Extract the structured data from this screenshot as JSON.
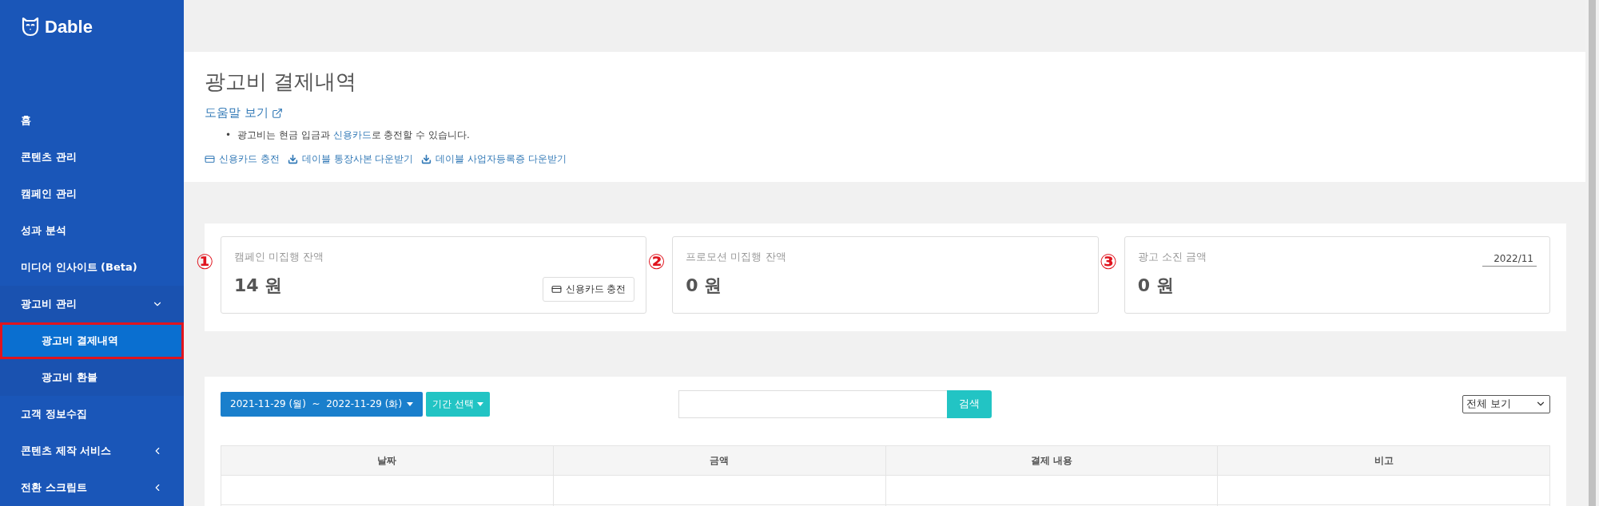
{
  "sidebar": {
    "logo": "Dable",
    "items": [
      {
        "label": "홈",
        "kind": "link",
        "selected": false,
        "highlighted": false
      },
      {
        "label": "콘텐츠 관리",
        "kind": "link",
        "selected": false,
        "highlighted": false
      },
      {
        "label": "캠페인 관리",
        "kind": "link",
        "selected": false,
        "highlighted": false
      },
      {
        "label": "성과 분석",
        "kind": "link",
        "selected": false,
        "highlighted": false
      },
      {
        "label": "미디어 인사이트 (Beta)",
        "kind": "link",
        "selected": false,
        "highlighted": false
      },
      {
        "label": "광고비 관리",
        "kind": "group",
        "expanded": true,
        "selected": false,
        "highlighted": false,
        "children": [
          {
            "label": "광고비 결제내역",
            "selected": true,
            "highlighted": true
          },
          {
            "label": "광고비 환불",
            "selected": false,
            "highlighted": false
          }
        ]
      },
      {
        "label": "고객 정보수집",
        "kind": "link",
        "selected": false,
        "highlighted": false
      },
      {
        "label": "콘텐츠 제작 서비스",
        "kind": "group",
        "expanded": false,
        "selected": false,
        "highlighted": false
      },
      {
        "label": "전환 스크립트",
        "kind": "group",
        "expanded": false,
        "selected": false,
        "highlighted": false
      }
    ]
  },
  "header": {
    "title": "광고비 결제내역",
    "help_link": "도움말 보기",
    "note": {
      "bullet": "•",
      "before": "광고비는 현금 입금과 ",
      "link": "신용카드",
      "after": "로 충전할 수 있습니다."
    },
    "actions": [
      {
        "kind": "card",
        "label": "신용카드 충전"
      },
      {
        "kind": "download",
        "label": "데이블 통장사본 다운받기"
      },
      {
        "kind": "download",
        "label": "데이블 사업자등록증 다운받기"
      }
    ]
  },
  "balances": [
    {
      "marker": "①",
      "label": "캠페인 미집행 잔액",
      "value": "14 원",
      "button": "신용카드 충전"
    },
    {
      "marker": "②",
      "label": "프로모션 미집행 잔액",
      "value": "0 원"
    },
    {
      "marker": "③",
      "label": "광고 소진 금액",
      "value": "0 원",
      "month": "2022/11"
    }
  ],
  "filters": {
    "date_range": "2021-11-29 (월)  ~  2022-11-29 (화)",
    "period_button": "기간 선택",
    "search_button": "검색",
    "view_select": "전체 보기"
  },
  "table": {
    "columns": [
      "날짜",
      "금액",
      "결제 내용",
      "비고"
    ]
  }
}
